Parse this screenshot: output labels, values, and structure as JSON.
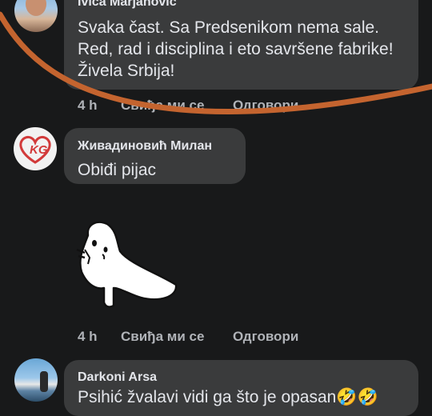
{
  "comments": [
    {
      "author": "Ivica Marjanović",
      "lines": [
        "Svaka čast. Sa Predsenikom nema sale.",
        "Red, rad i disciplina i eto savršene fabrike!",
        "Živela Srbija!"
      ],
      "time": "4 h",
      "like_label": "Свиђа ми се",
      "reply_label": "Одговори"
    },
    {
      "author": "Живадиновић Милан",
      "avatar_text": "KG",
      "text": "Obiđi pijac",
      "sticker": "ghost-sticker",
      "time": "4 h",
      "like_label": "Свиђа ми се",
      "reply_label": "Одговори"
    },
    {
      "author": "Darkoni Arsa",
      "text": "Psihić žvalavi vidi ga što je opasan🤣🤣"
    }
  ],
  "colors": {
    "background": "#18191a",
    "bubble": "#3a3b3c",
    "text": "#e4e6eb",
    "meta": "#b0b3b8",
    "annotation": "#c4642f"
  }
}
